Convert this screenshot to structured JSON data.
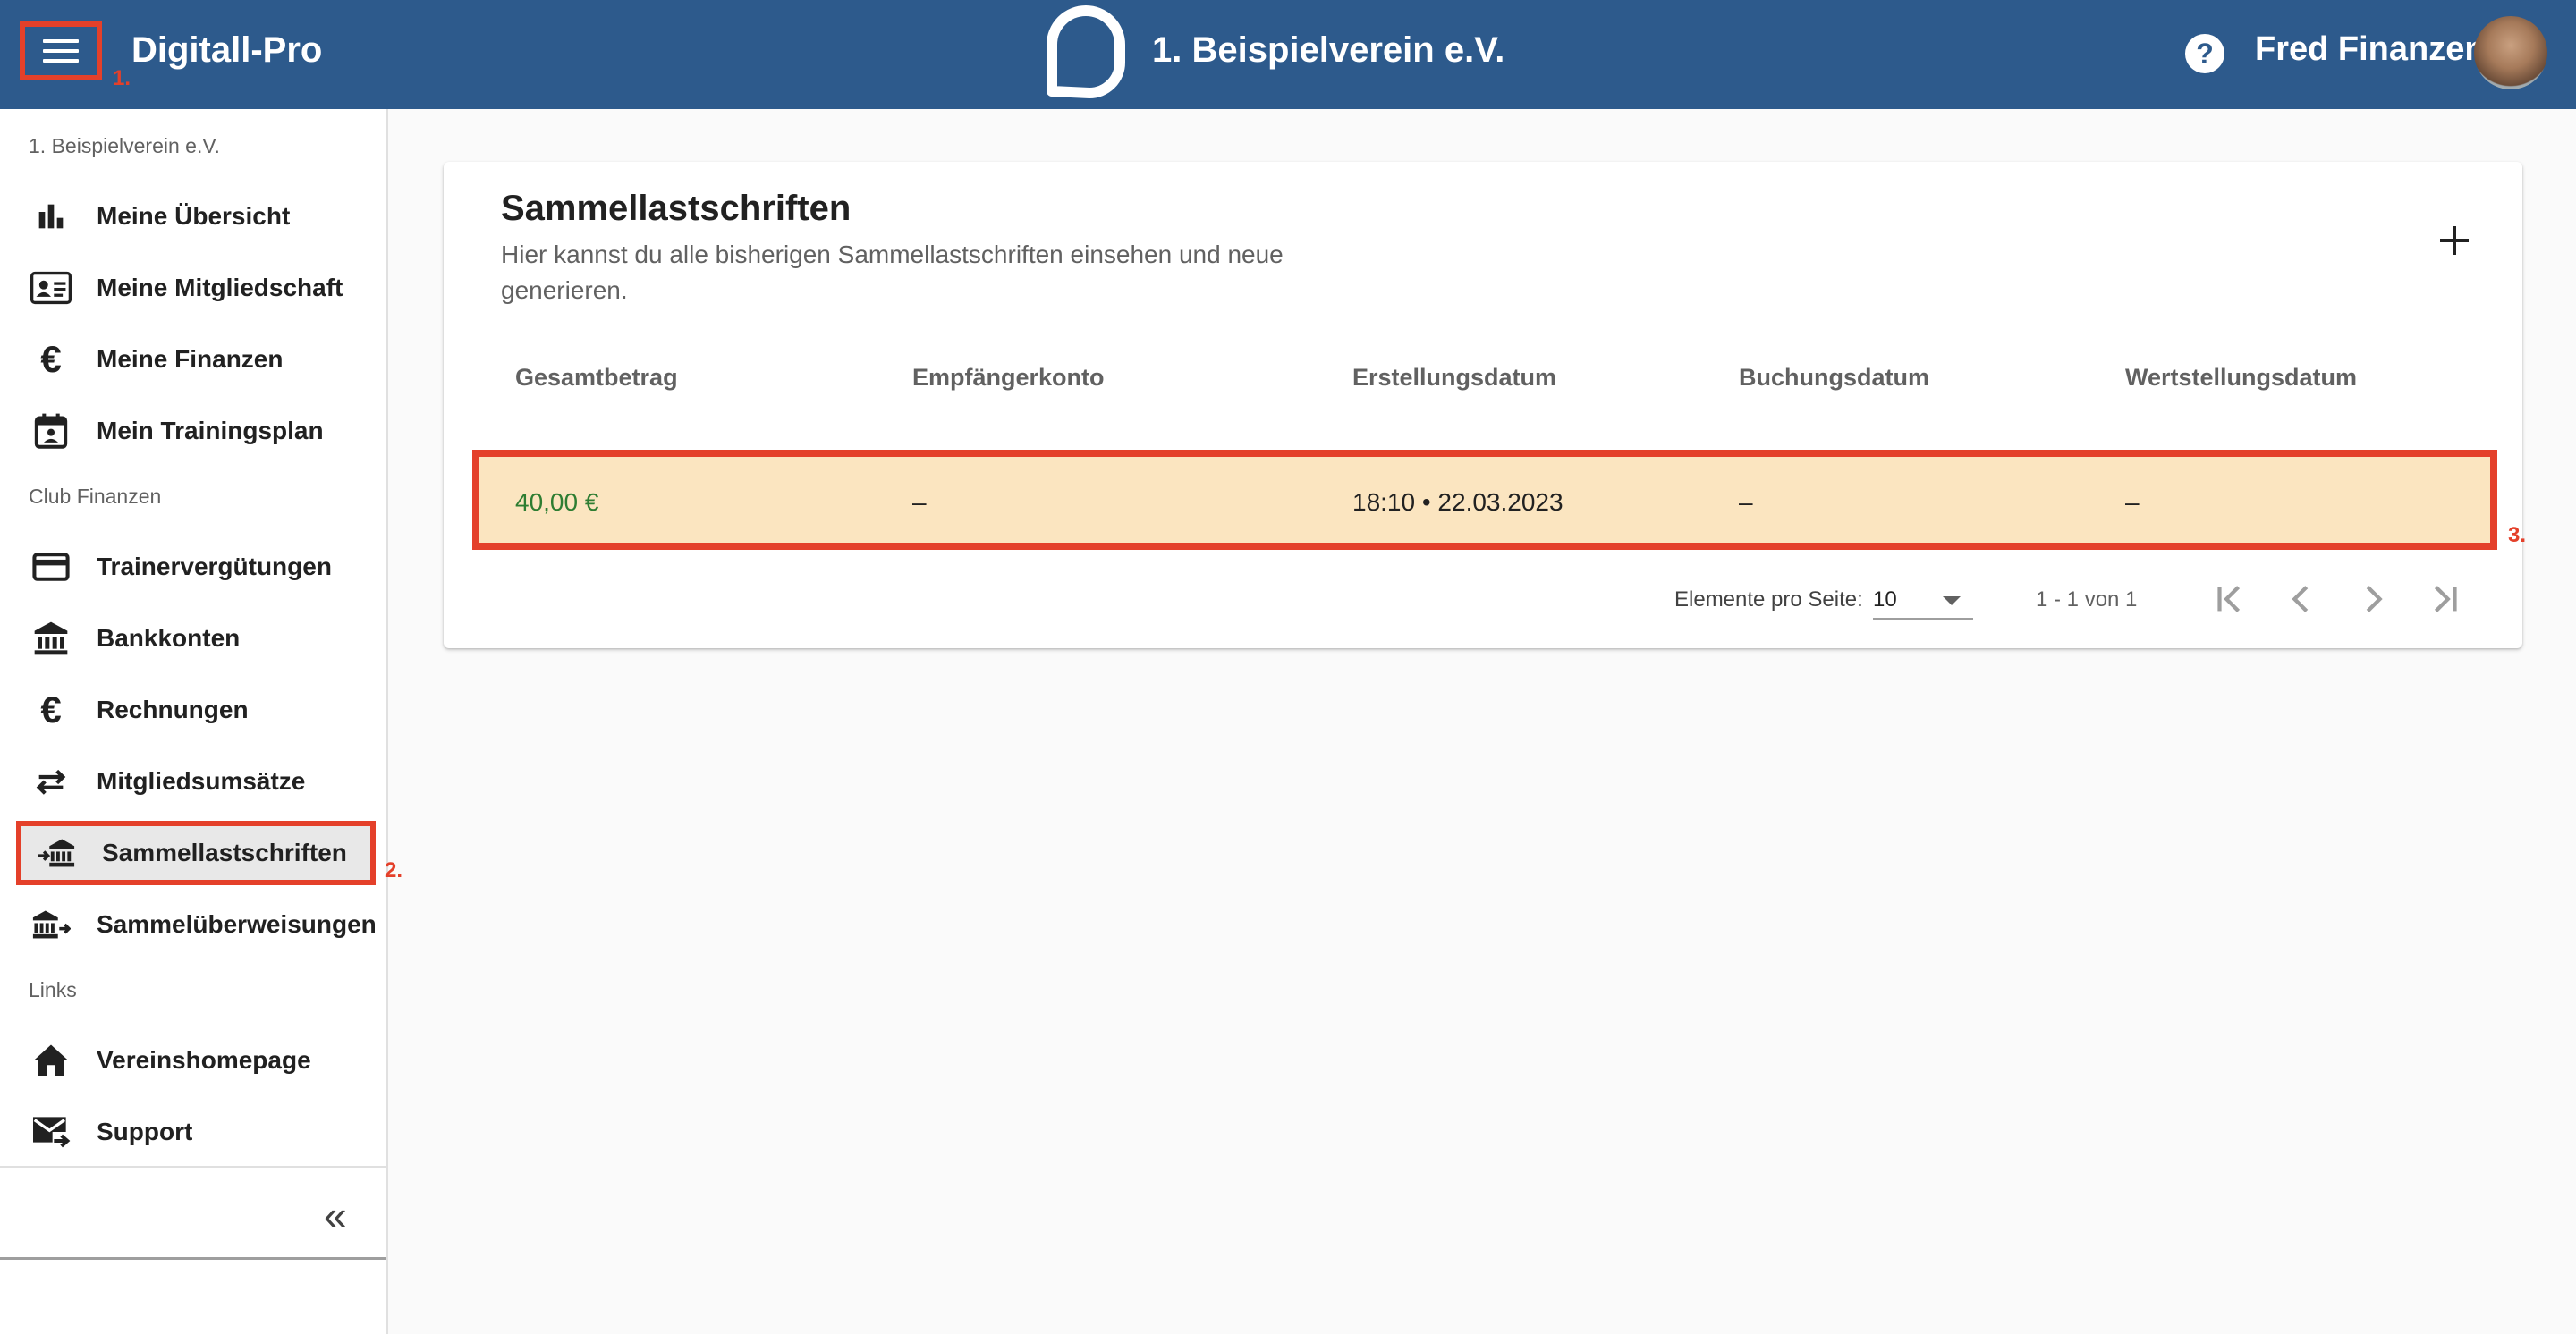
{
  "header": {
    "app_title": "Digitall-Pro",
    "club_name": "1. Beispielverein e.V.",
    "user_name": "Fred Finanzen",
    "brand_color": "#2d5a8c"
  },
  "annotations": {
    "step1": "1.",
    "step2": "2.",
    "step3": "3.",
    "highlight_color": "#e4402a"
  },
  "sidebar": {
    "club_label": "1. Beispielverein e.V.",
    "sections": [
      {
        "label": "",
        "items": [
          {
            "label": "Meine Übersicht",
            "icon": "bar-chart-icon"
          },
          {
            "label": "Meine Mitgliedschaft",
            "icon": "id-card-icon"
          },
          {
            "label": "Meine Finanzen",
            "icon": "euro-icon"
          },
          {
            "label": "Mein Trainingsplan",
            "icon": "calendar-icon"
          }
        ]
      },
      {
        "label": "Club Finanzen",
        "items": [
          {
            "label": "Trainervergütungen",
            "icon": "credit-card-icon"
          },
          {
            "label": "Bankkonten",
            "icon": "bank-icon"
          },
          {
            "label": "Rechnungen",
            "icon": "euro-icon"
          },
          {
            "label": "Mitgliedsumsätze",
            "icon": "swap-arrows-icon"
          },
          {
            "label": "Sammellastschriften",
            "icon": "bank-incoming-icon",
            "active": true
          },
          {
            "label": "Sammelüberweisungen",
            "icon": "bank-outgoing-icon"
          }
        ]
      },
      {
        "label": "Links",
        "items": [
          {
            "label": "Vereinshomepage",
            "icon": "home-icon"
          },
          {
            "label": "Support",
            "icon": "mail-forward-icon"
          }
        ]
      }
    ],
    "collapse_icon": "double-chevron-left-icon"
  },
  "main": {
    "title": "Sammellastschriften",
    "subtitle": "Hier kannst du alle bisherigen Sammellastschriften einsehen und neue generieren.",
    "add_icon": "plus-icon",
    "table": {
      "columns": [
        "Gesamtbetrag",
        "Empfängerkonto",
        "Erstellungsdatum",
        "Buchungsdatum",
        "Wertstellungsdatum"
      ],
      "rows": [
        [
          "40,00 €",
          "–",
          "18:10 • 22.03.2023",
          "–",
          "–"
        ]
      ],
      "row_highlight_color": "#fbe5c0",
      "amount_color": "#2e7d32"
    },
    "pagination": {
      "per_page_label": "Elemente pro Seite:",
      "per_page_value": "10",
      "range_text": "1 - 1 von 1",
      "icons": [
        "first-page-icon",
        "prev-page-icon",
        "next-page-icon",
        "last-page-icon"
      ]
    }
  }
}
